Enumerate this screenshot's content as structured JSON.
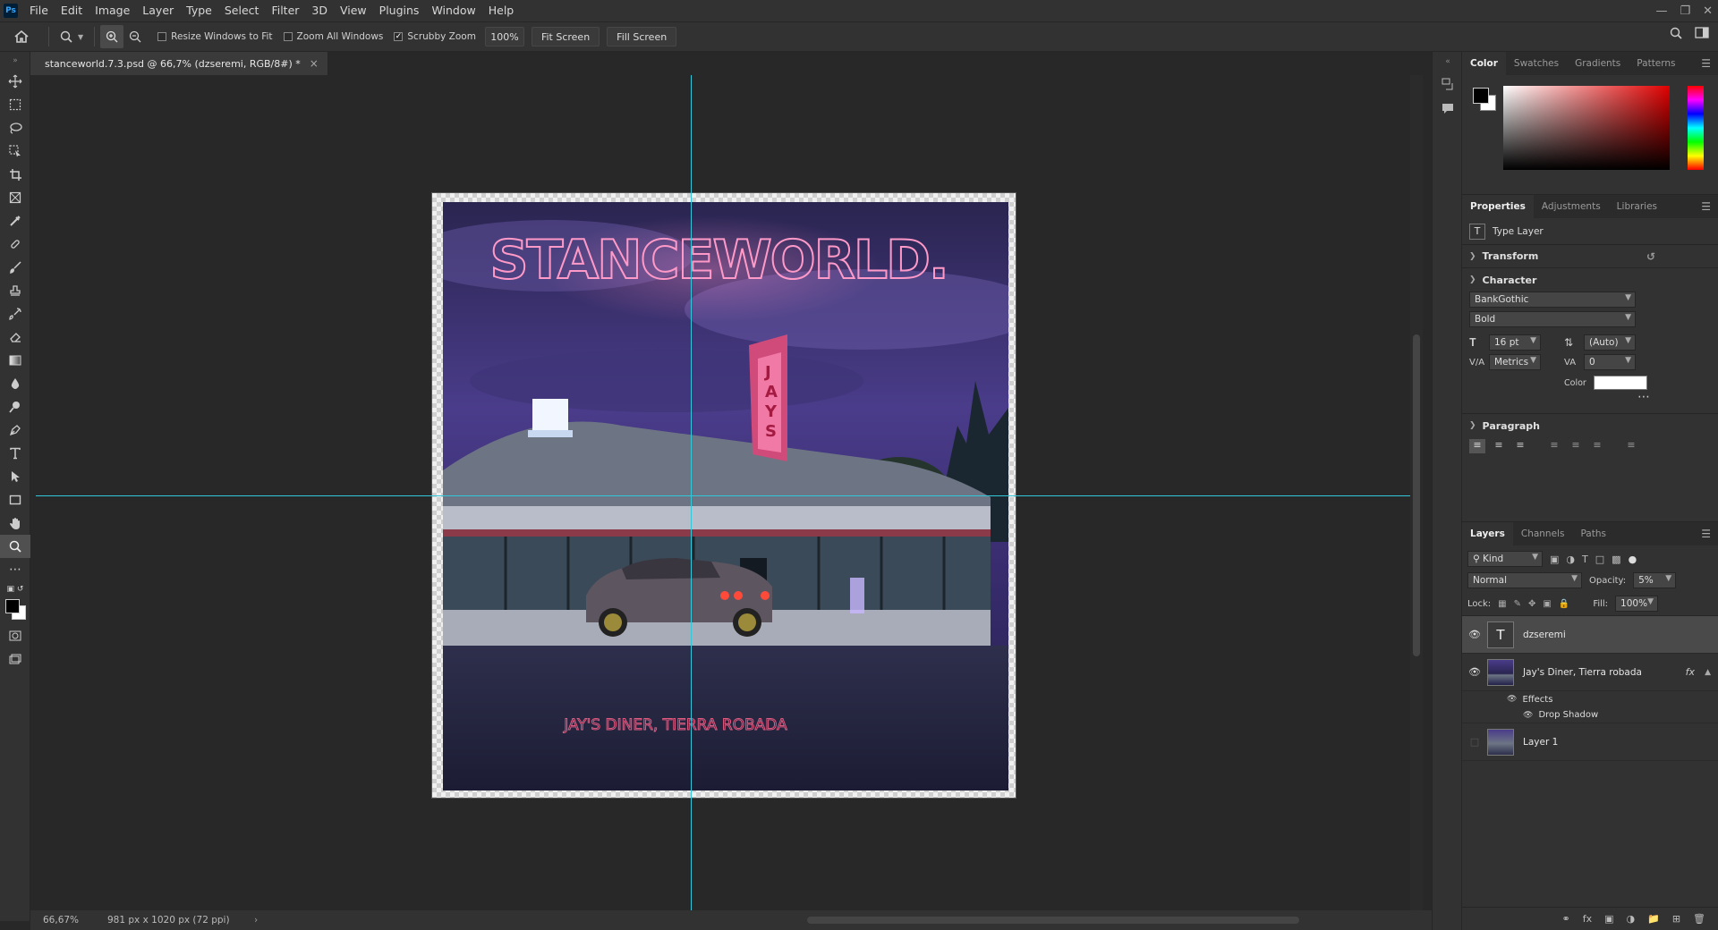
{
  "app": {
    "logo": "Ps",
    "menu": [
      "File",
      "Edit",
      "Image",
      "Layer",
      "Type",
      "Select",
      "Filter",
      "3D",
      "View",
      "Plugins",
      "Window",
      "Help"
    ]
  },
  "options_bar": {
    "resize_windows": "Resize Windows to Fit",
    "zoom_all": "Zoom All Windows",
    "scrubby_zoom": "Scrubby Zoom",
    "zoom_value": "100%",
    "fit_screen": "Fit Screen",
    "fill_screen": "Fill Screen"
  },
  "document": {
    "tab_title": "stanceworld.7.3.psd @ 66,7% (dzseremi, RGB/8#) *"
  },
  "artwork": {
    "headline": "STANCEWORLD.",
    "sign": "JAYS",
    "caption": "JAY'S DINER, TIERRA ROBADA"
  },
  "status": {
    "zoom": "66,67%",
    "doc_info": "981 px x 1020 px (72 ppi)"
  },
  "color_panel": {
    "tabs": [
      "Color",
      "Swatches",
      "Gradients",
      "Patterns"
    ]
  },
  "properties_panel": {
    "tabs": [
      "Properties",
      "Adjustments",
      "Libraries"
    ],
    "layer_type": "Type Layer",
    "transform": "Transform",
    "character": "Character",
    "font_family": "BankGothic",
    "font_style": "Bold",
    "font_size": "16 pt",
    "leading": "(Auto)",
    "kerning": "Metrics",
    "tracking": "0",
    "color_label": "Color",
    "paragraph": "Paragraph"
  },
  "layers_panel": {
    "tabs": [
      "Layers",
      "Channels",
      "Paths"
    ],
    "filter_kind": "Kind",
    "blend_mode": "Normal",
    "opacity_label": "Opacity:",
    "opacity_value": "5%",
    "lock_label": "Lock:",
    "fill_label": "Fill:",
    "fill_value": "100%",
    "layers": [
      {
        "name": "dzseremi"
      },
      {
        "name": "Jay's Diner, Tierra robada",
        "fx": "fx"
      },
      {
        "name": "Layer 1"
      }
    ],
    "effects_label": "Effects",
    "drop_shadow": "Drop Shadow"
  }
}
